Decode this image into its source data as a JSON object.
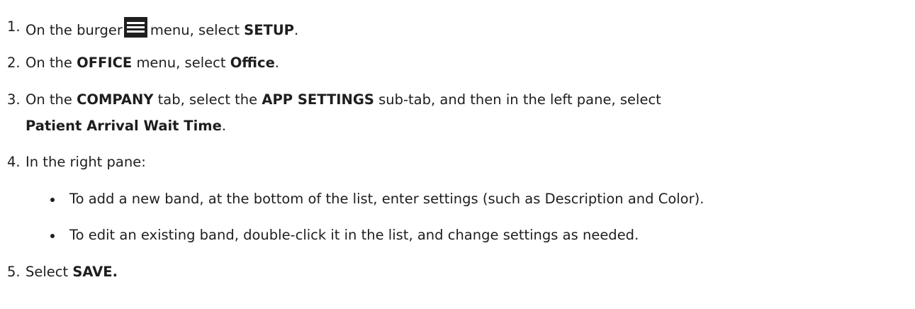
{
  "steps": [
    {
      "num": "1.",
      "t1": "On the burger",
      "t2": "menu, select",
      "b1": "SETUP",
      "t3": "."
    },
    {
      "num": "2.",
      "t1": "On the",
      "b1": "OFFICE",
      "t2": "menu, select",
      "b2": "Office",
      "t3": "."
    },
    {
      "num": "3.",
      "t1": "On the",
      "b1": "COMPANY",
      "t2": "tab, select the",
      "b2": "APP SETTINGS",
      "t3": "sub-tab, and then in the left pane, select",
      "b3": "Patient Arrival Wait Time",
      "t4": "."
    },
    {
      "num": "4.",
      "t1": "In the right pane:"
    },
    {
      "num": "5.",
      "t1": "Select",
      "b1": "SAVE."
    }
  ],
  "bullets": [
    "To add a new band, at the bottom of the list, enter settings (such as Description and Color).",
    "To edit an existing band, double-click it in the list, and change settings as needed."
  ],
  "icons": {
    "burger_menu": "burger-menu-icon"
  }
}
